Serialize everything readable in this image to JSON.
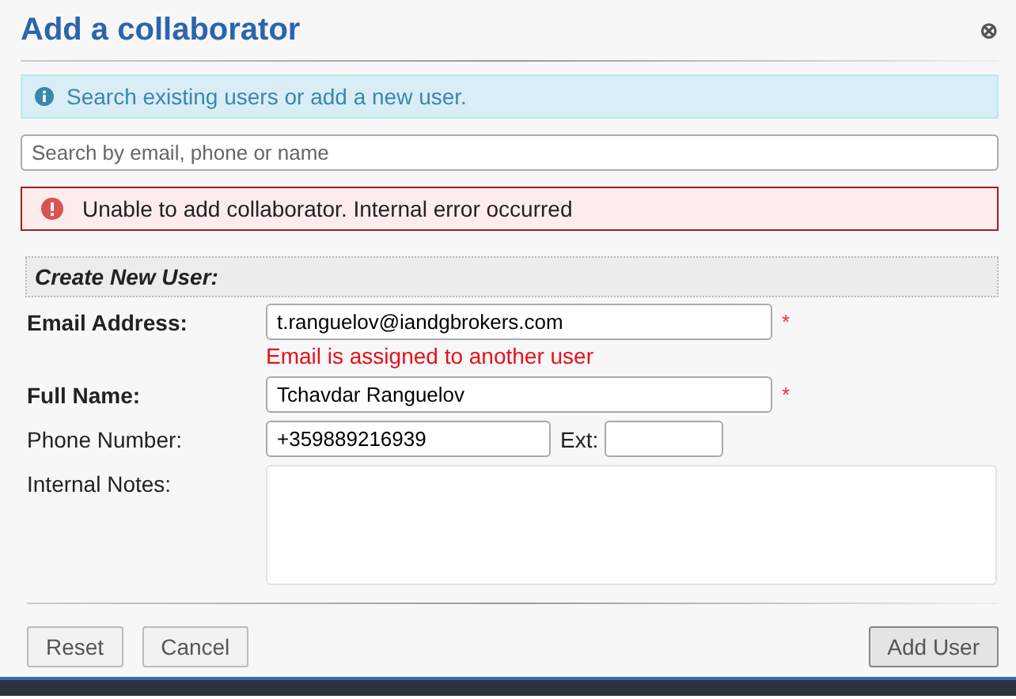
{
  "dialog": {
    "title": "Add a collaborator",
    "close_icon": "⊗"
  },
  "info": "Search existing users or add a new user.",
  "search": {
    "placeholder": "Search by email, phone or name"
  },
  "error": "Unable to add collaborator. Internal error occurred",
  "section_title": "Create New User:",
  "fields": [
    {
      "kind": "input",
      "label": "Email Address:",
      "bold": true,
      "value": "t.ranguelov@iandgbrokers.com",
      "required_mark": "*",
      "error": "Email is assigned to another user"
    },
    {
      "kind": "input",
      "label": "Full Name:",
      "bold": true,
      "value": "Tchavdar Ranguelov",
      "required_mark": "*"
    },
    {
      "kind": "phone",
      "label": "Phone Number:",
      "bold": false,
      "value": "+359889216939",
      "ext_label": "Ext:"
    },
    {
      "kind": "textarea",
      "label": "Internal Notes:",
      "bold": false
    }
  ],
  "buttons": [
    {
      "label": "Reset",
      "primary": false
    },
    {
      "label": "Cancel",
      "primary": false
    },
    {
      "label": "Add User",
      "primary": true
    }
  ]
}
